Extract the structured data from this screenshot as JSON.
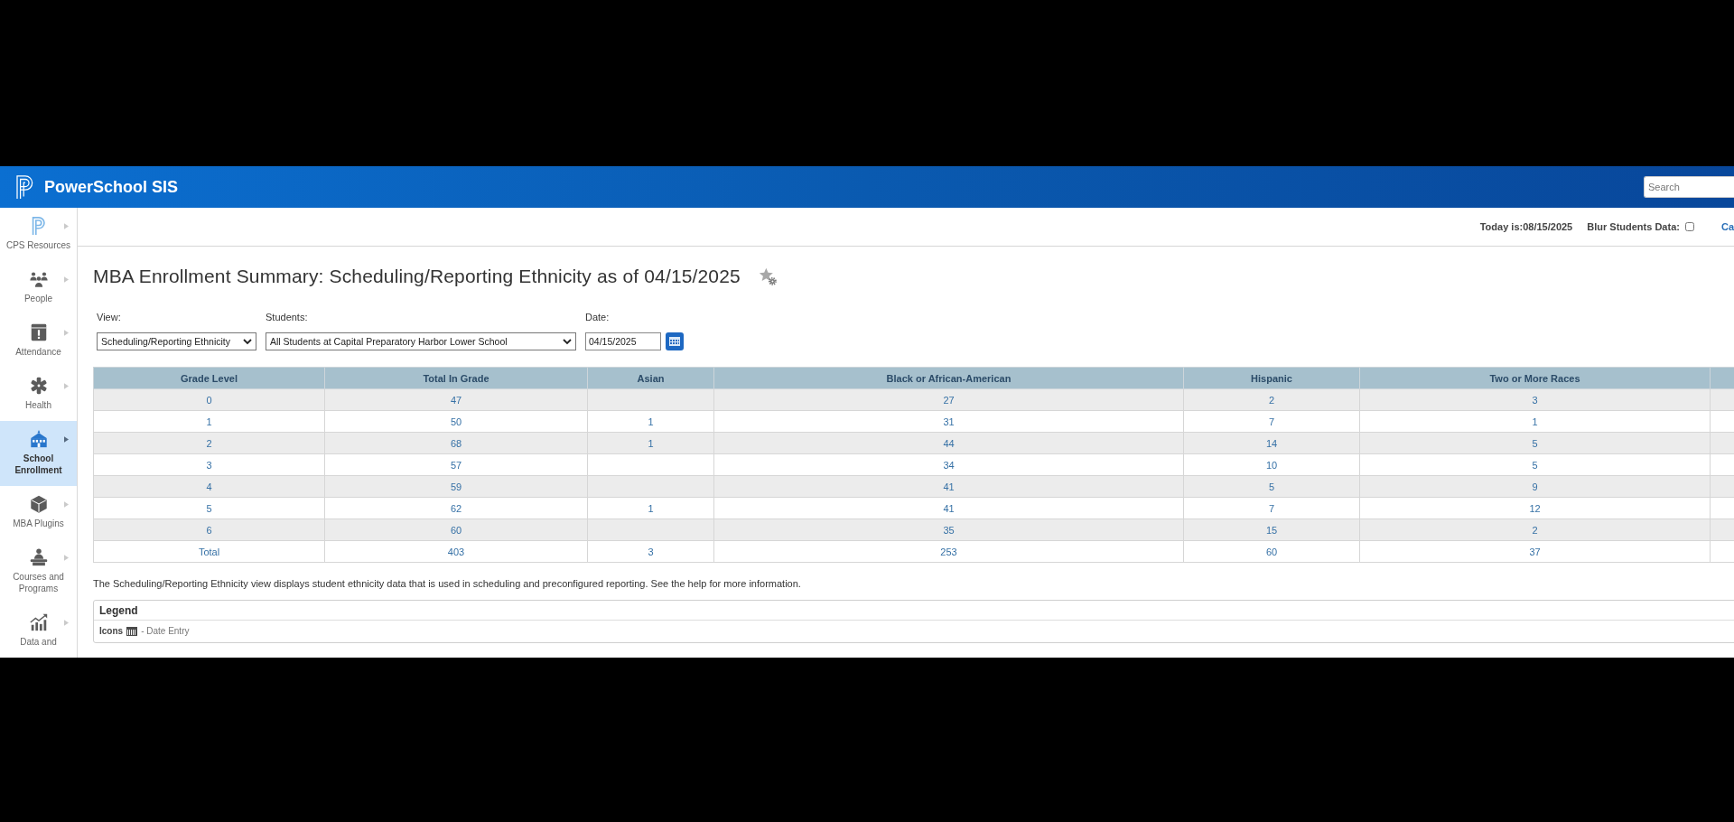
{
  "header": {
    "app_name": "PowerSchool SIS",
    "search": {
      "placeholder": "Search"
    }
  },
  "sidebar": {
    "items": [
      {
        "label": "CPS Resources",
        "selected": false
      },
      {
        "label": "People",
        "selected": false
      },
      {
        "label": "Attendance",
        "selected": false
      },
      {
        "label": "Health",
        "selected": false
      },
      {
        "label": "School Enrollment",
        "selected": true
      },
      {
        "label": "MBA Plugins",
        "selected": false
      },
      {
        "label": "Courses and Programs",
        "selected": false
      },
      {
        "label": "Data and",
        "selected": false
      }
    ]
  },
  "top_bar": {
    "today": "Today is:08/15/2025",
    "blur": {
      "label": "Blur Students Data:",
      "checked": false
    },
    "link": "Ca"
  },
  "page": {
    "title": "MBA Enrollment Summary: Scheduling/Reporting Ethnicity as of 04/15/2025",
    "filters": [
      {
        "kind": "select",
        "label": "View:",
        "value": "Scheduling/Reporting Ethnicity"
      },
      {
        "kind": "select",
        "label": "Students:",
        "value": "All Students at Capital Preparatory Harbor Lower School"
      },
      {
        "kind": "date",
        "label": "Date:",
        "value": "04/15/2025"
      }
    ]
  },
  "table": {
    "columns": [
      "Grade Level",
      "Total In Grade",
      "Asian",
      "Black or African-American",
      "Hispanic",
      "Two or More Races"
    ],
    "rows": [
      [
        "0",
        "47",
        null,
        "27",
        "2",
        "3"
      ],
      [
        "1",
        "50",
        "1",
        "31",
        "7",
        "1"
      ],
      [
        "2",
        "68",
        "1",
        "44",
        "14",
        "5"
      ],
      [
        "3",
        "57",
        null,
        "34",
        "10",
        "5"
      ],
      [
        "4",
        "59",
        null,
        "41",
        "5",
        "9"
      ],
      [
        "5",
        "62",
        "1",
        "41",
        "7",
        "12"
      ],
      [
        "6",
        "60",
        null,
        "35",
        "15",
        "2"
      ],
      [
        "Total",
        "403",
        "3",
        "253",
        "60",
        "37"
      ]
    ]
  },
  "description": "The Scheduling/Reporting Ethnicity view displays student ethnicity data that is used in scheduling and preconfigured reporting. See the help for more information.",
  "legend": {
    "title": "Legend",
    "label": "Icons",
    "entries": [
      {
        "text": "- Date Entry"
      }
    ]
  }
}
